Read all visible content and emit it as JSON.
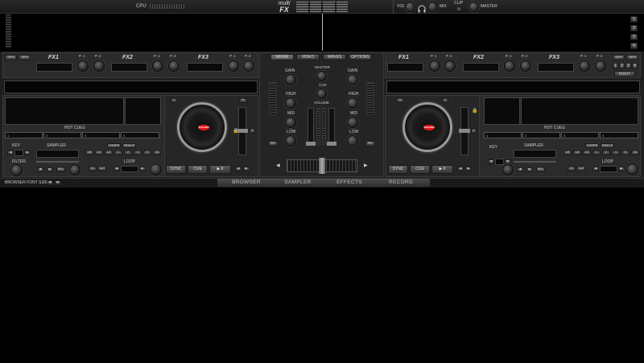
{
  "topbar": {
    "cpu_label": "CPU",
    "logo_line1": "multi",
    "logo_line2": "FX",
    "vol_label": "VOL",
    "mix_label": "MIX",
    "clip_label": "CLIP",
    "master_label": "MASTER"
  },
  "waveform_numbers": [
    "1",
    "2",
    "3",
    "4"
  ],
  "fx_units": [
    {
      "name": "FX1",
      "p1": "P. 1",
      "p2": "P. 2"
    },
    {
      "name": "FX2",
      "p1": "P. 1",
      "p2": "P. 2"
    },
    {
      "name": "FX3",
      "p1": "P. 1",
      "p2": "P. 2"
    }
  ],
  "tape_label": "TAPE",
  "deck_select": [
    "1",
    "2",
    "3",
    "4"
  ],
  "right_label": "RIGHT",
  "center_tabs": [
    "MIXER",
    "VIDEO",
    "WAVES",
    "OPTIONS"
  ],
  "mixer": {
    "gain": "GAIN",
    "high": "HIGH",
    "mid": "MID",
    "low": "LOW",
    "master": "MASTER",
    "cue": "CUE",
    "volume": "VOLUME",
    "pfl": "PFL"
  },
  "deck": {
    "hot_cues": "HOT CUES",
    "cue_slots": [
      "1",
      "2",
      "3",
      "4"
    ],
    "key": "KEY",
    "filter": "FILTER",
    "sampler": "SAMPLER",
    "loops": "LOOPS",
    "rolls": "ROLLS",
    "loop": "LOOP",
    "in": "IN",
    "out": "OUT",
    "rec": "REC",
    "sync": "SYNC",
    "cue": "CUE",
    "play": "▶ II",
    "loop_sizes": [
      "1/8",
      "1/4",
      "1/2",
      "1",
      "2",
      "4",
      "8",
      "16"
    ],
    "platter_label": "VirtualDJ",
    "deck_left_num": "1",
    "deck_right_num": "2",
    "pitch_zero": "0"
  },
  "bottom": {
    "browser_font_size": "BROWSER FONT SIZE",
    "tabs": [
      "BROWSER",
      "SAMPLER",
      "EFFECTS",
      "RECORD"
    ]
  },
  "colors": {
    "background": "#000000",
    "panel": "#2b2b2b",
    "accent_red": "#e01818",
    "tab_active": "#4a4a4a"
  }
}
